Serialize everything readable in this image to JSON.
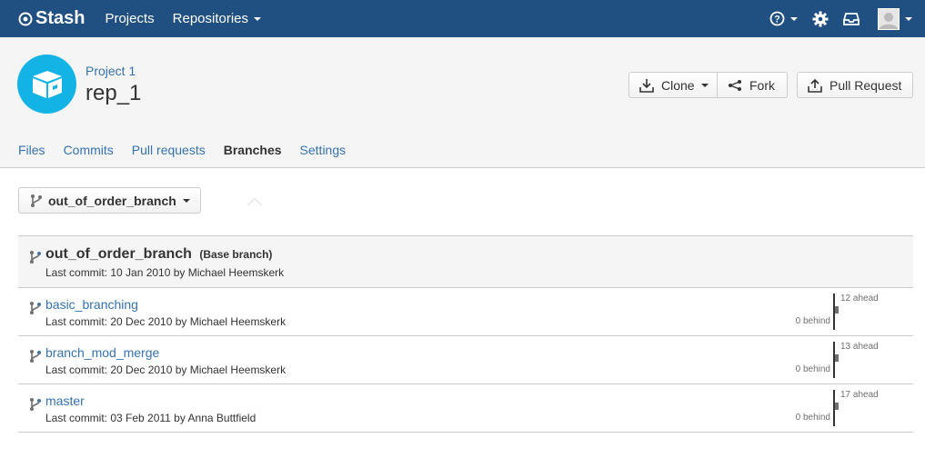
{
  "topbar": {
    "brand": "Stash",
    "nav": [
      "Projects",
      "Repositories"
    ]
  },
  "header": {
    "project_link": "Project 1",
    "repo_name": "rep_1",
    "buttons": {
      "clone": "Clone",
      "fork": "Fork",
      "pull_request": "Pull Request"
    }
  },
  "tabs": [
    {
      "label": "Files",
      "active": false
    },
    {
      "label": "Commits",
      "active": false
    },
    {
      "label": "Pull requests",
      "active": false
    },
    {
      "label": "Branches",
      "active": true
    },
    {
      "label": "Settings",
      "active": false
    }
  ],
  "branch_selector": {
    "value": "out_of_order_branch"
  },
  "base_branch": {
    "name": "out_of_order_branch",
    "tag": "(Base branch)",
    "last_commit": "Last commit: 10 Jan 2010 by Michael Heemskerk"
  },
  "branches": [
    {
      "name": "basic_branching",
      "last_commit": "Last commit: 20 Dec 2010 by Michael Heemskerk",
      "ahead": "12 ahead",
      "behind": "0 behind"
    },
    {
      "name": "branch_mod_merge",
      "last_commit": "Last commit: 20 Dec 2010 by Michael Heemskerk",
      "ahead": "13 ahead",
      "behind": "0 behind"
    },
    {
      "name": "master",
      "last_commit": "Last commit: 03 Feb 2011 by Anna Buttfield",
      "ahead": "17 ahead",
      "behind": "0 behind"
    }
  ],
  "colors": {
    "topbar": "#205081",
    "link": "#3572b0",
    "project_avatar": "#14b3e6"
  },
  "icons": {
    "help": "help-icon",
    "settings": "gear-icon",
    "inbox": "inbox-icon",
    "user": "user-avatar-icon",
    "branch": "branch-icon",
    "clone": "download-icon",
    "fork": "fork-icon",
    "pull_request": "upload-icon"
  }
}
